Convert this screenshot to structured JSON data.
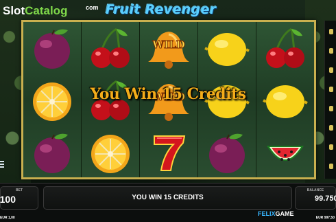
{
  "watermark": {
    "slot": "Slot",
    "catalog": "Catalog",
    "com": "com"
  },
  "game": {
    "title": "Fruit Revenger"
  },
  "reels": [
    [
      "plum",
      "orange",
      "plum"
    ],
    [
      "cherry",
      "cherry",
      "orange"
    ],
    [
      "wild-bell",
      "wild-bell",
      "seven"
    ],
    [
      "lemon",
      "lemon",
      "plum"
    ],
    [
      "cherry",
      "lemon",
      "watermelon"
    ]
  ],
  "wild_label": "WILD",
  "win_overlay": "You Win 15 Credits",
  "bottom_bar": {
    "bet_label": "BET",
    "bet_value": "100",
    "bet_sub": "EUR 1,00",
    "message": "YOU WIN 15 CREDITS",
    "balance_label": "BALANCE",
    "balance_value": "99.750",
    "balance_sub": "EUR 997,50",
    "provider_a": "FELIX",
    "provider_b": "GAME"
  },
  "colors": {
    "frame": "#c9b04f",
    "win_text": "#f4ad1a",
    "title": "#5ad0ff",
    "reel_bg": "#25452a"
  },
  "icons": {
    "menu": "hamburger-menu-icon"
  }
}
